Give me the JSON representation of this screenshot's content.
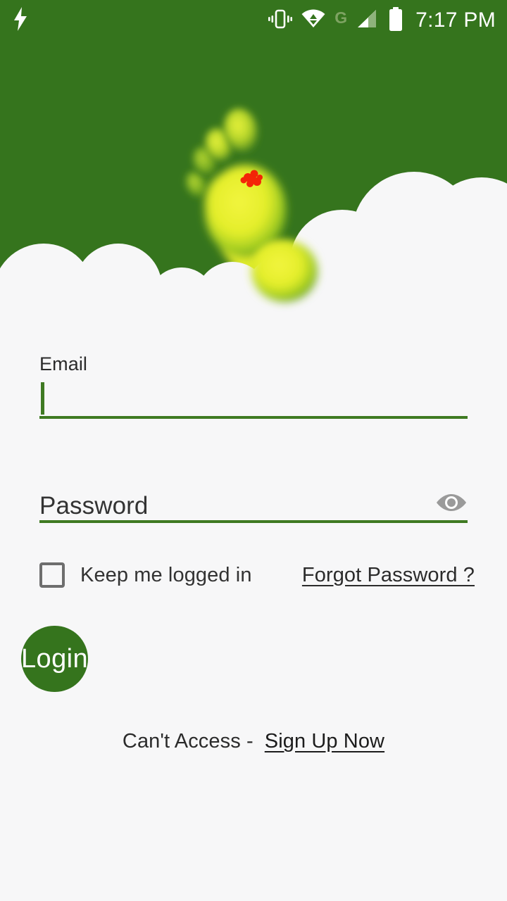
{
  "status_bar": {
    "charging_icon": "lightning-bolt-icon",
    "vibrate_icon": "vibrate-icon",
    "wifi_icon": "wifi-transfer-icon",
    "network_label": "G",
    "signal_icon": "signal-bars-icon",
    "battery_icon": "battery-full-icon",
    "time": "7:17 PM"
  },
  "hero": {
    "logo_name": "footprint-logo",
    "background_color": "#35741d",
    "cloud_color": "#f7f7f8",
    "foot_color_light": "#e9f03c",
    "foot_color_edge": "#86c020",
    "mark_color": "#f51b06"
  },
  "form": {
    "email": {
      "label": "Email",
      "value": "",
      "placeholder": ""
    },
    "password": {
      "label": "",
      "value": "",
      "placeholder": "Password",
      "toggle_icon": "eye-icon"
    },
    "keep_logged_in": {
      "label": "Keep me logged in",
      "checked": false
    },
    "forgot_password": "Forgot Password ?",
    "login_button": "Login",
    "signup_prefix": "Can't Access -",
    "signup_link": "Sign Up Now"
  },
  "theme": {
    "primary": "#35741d",
    "underline": "#3f7a22",
    "page_bg": "#f7f7f8",
    "text": "#2b2b2b"
  }
}
